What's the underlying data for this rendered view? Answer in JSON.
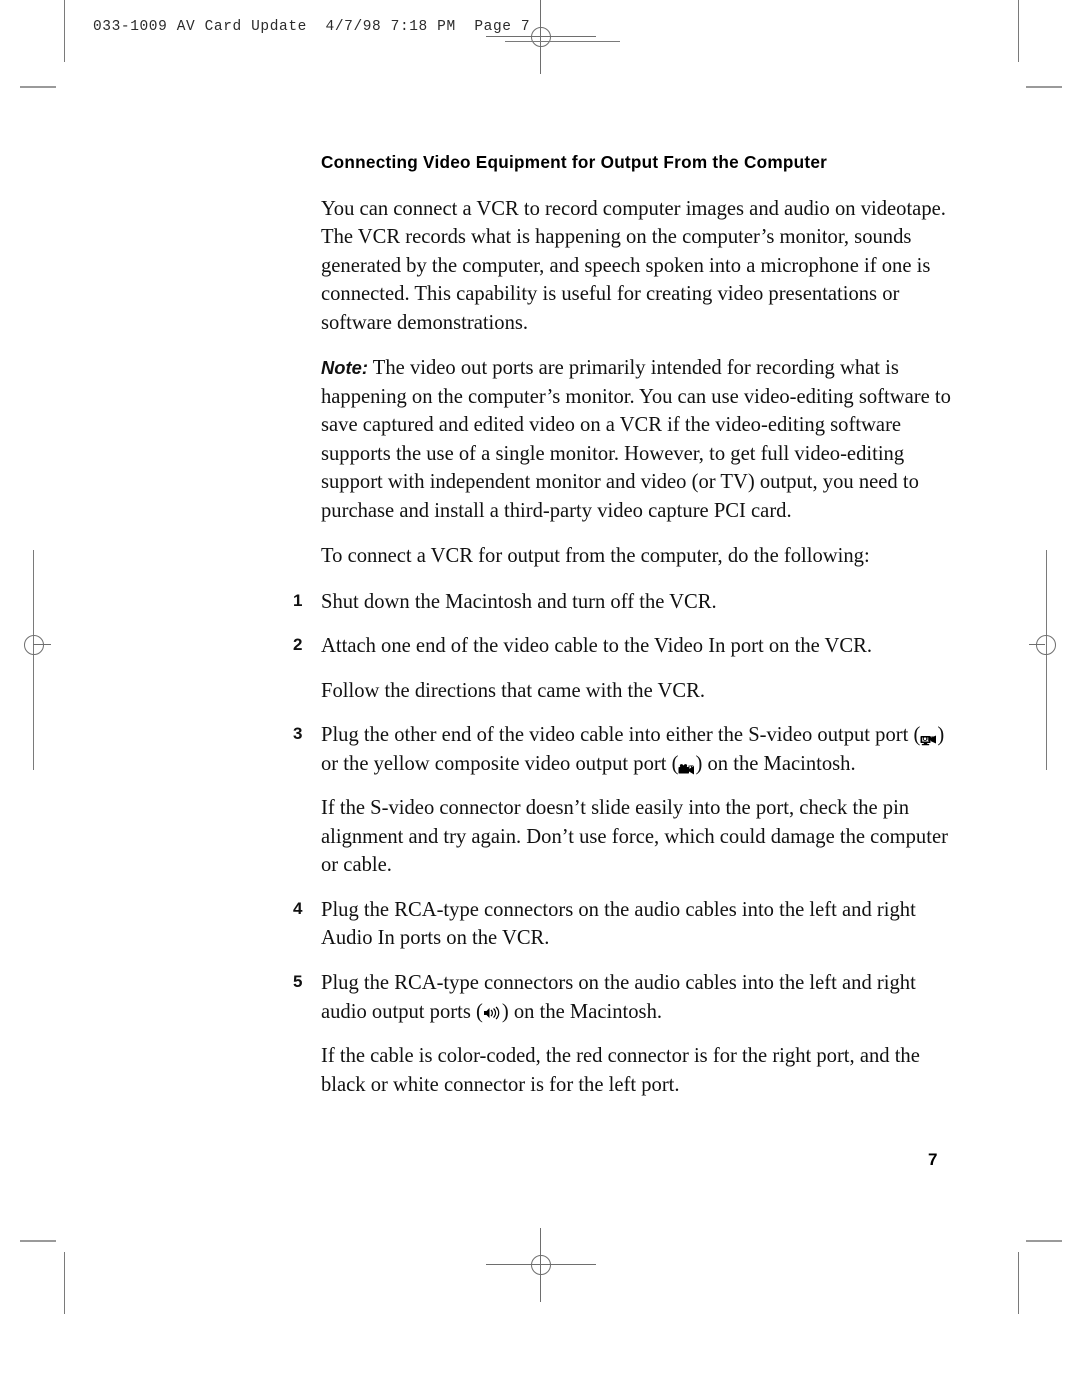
{
  "page": {
    "slug": "033-1009 AV Card Update  4/7/98 7:18 PM  Page 7",
    "folio": "7"
  },
  "section": {
    "title": "Connecting Video Equipment for Output From the Computer"
  },
  "intro": {
    "paragraph": "You can connect a VCR to record computer images and audio on videotape. The VCR records what is happening on the computer’s monitor, sounds generated by the computer, and speech spoken into a microphone if one is connected. This capability is useful for creating video presentations or software demonstrations."
  },
  "note": {
    "label": "Note:",
    "text": "The video out ports are primarily intended for recording what is happening on the computer’s monitor. You can use video-editing software to save captured and edited video on a VCR if the video-editing software supports the use of a single monitor. However, to get full video-editing support with independent monitor and video (or TV) output, you need to purchase and install a third-party video capture PCI card."
  },
  "lead_in": {
    "text": "To connect a VCR for output from the computer, do the following:"
  },
  "steps": [
    {
      "num": "1",
      "text": "Shut down the Macintosh and turn off the VCR."
    },
    {
      "num": "2",
      "text": "Attach one end of the video cable to the Video In port on the VCR."
    },
    {
      "num": "3",
      "text_before_icon1": "Plug the other end of the video cable into either the S-video output port (",
      "text_between_icons": ") or the yellow composite video output port (",
      "text_after_icon2": ") on the Macintosh."
    },
    {
      "num": "4",
      "text": "Plug the RCA-type connectors on the audio cables into the left and right Audio In ports on the VCR."
    },
    {
      "num": "5",
      "text_before_icon": "Plug the RCA-type connectors on the audio cables into the left and right audio output ports (",
      "text_after_icon": ") on the Macintosh."
    }
  ],
  "substeps": {
    "after_step2": "Follow the directions that came with the VCR.",
    "after_step3": "If the S-video connector doesn’t slide easily into the port, check the pin alignment and try again. Don’t use force, which could damage the computer or cable.",
    "after_step5": "If the cable is color-coded, the red connector is for the right port, and the black or white connector is for the left port."
  },
  "icons": {
    "svideo_out_label": "OUT",
    "composite_out_label": "OUT"
  }
}
